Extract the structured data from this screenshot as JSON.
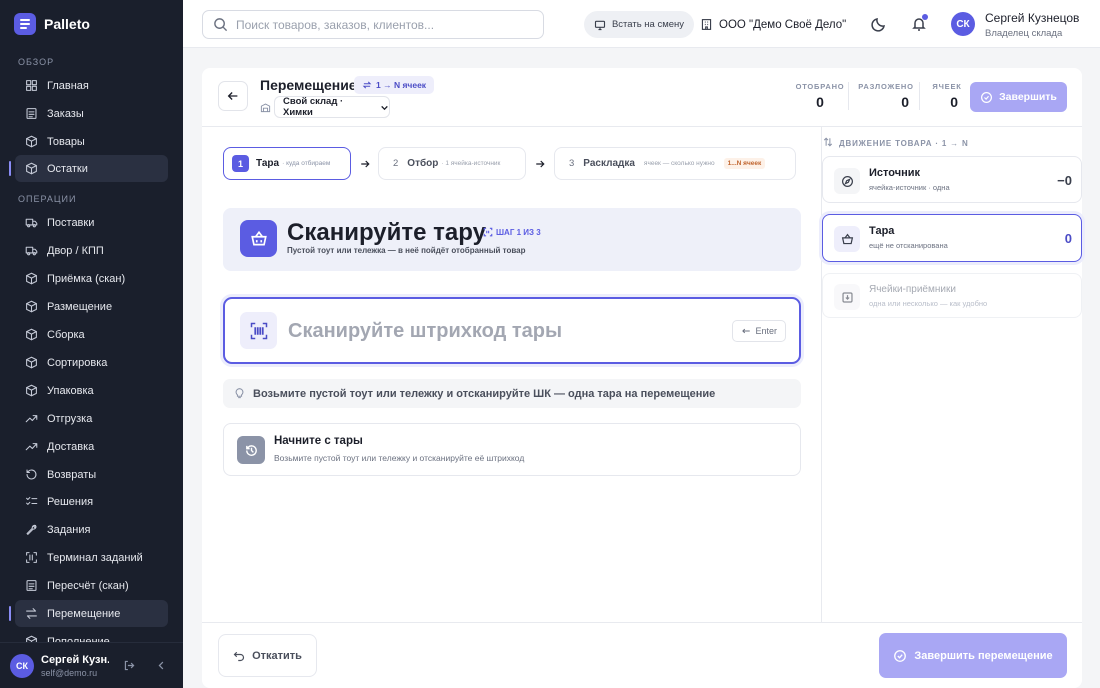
{
  "brand": {
    "name": "Palleto"
  },
  "sidebar": {
    "section_overview": "ОБЗОР",
    "section_operations": "ОПЕРАЦИИ",
    "items": [
      {
        "label": "Главная",
        "icon": "grid-icon"
      },
      {
        "label": "Заказы",
        "icon": "list-icon"
      },
      {
        "label": "Товары",
        "icon": "box-icon"
      },
      {
        "label": "Остатки",
        "icon": "box-icon"
      },
      {
        "label": "Поставки",
        "icon": "truck-icon"
      },
      {
        "label": "Двор / КПП",
        "icon": "truck-icon"
      },
      {
        "label": "Приёмка (скан)",
        "icon": "box-icon"
      },
      {
        "label": "Размещение",
        "icon": "box-icon"
      },
      {
        "label": "Сборка",
        "icon": "box-icon"
      },
      {
        "label": "Сортировка",
        "icon": "box-icon"
      },
      {
        "label": "Упаковка",
        "icon": "box-icon"
      },
      {
        "label": "Отгрузка",
        "icon": "trend-up-icon"
      },
      {
        "label": "Доставка",
        "icon": "trend-up-icon"
      },
      {
        "label": "Возвраты",
        "icon": "rotate-ccw-icon"
      },
      {
        "label": "Решения",
        "icon": "list-checks-icon"
      },
      {
        "label": "Задания",
        "icon": "wrench-icon"
      },
      {
        "label": "Терминал заданий",
        "icon": "scan-icon"
      },
      {
        "label": "Пересчёт (скан)",
        "icon": "list-icon"
      },
      {
        "label": "Перемещение",
        "icon": "arrows-swap-icon"
      },
      {
        "label": "Пополнение",
        "icon": "box-icon"
      }
    ],
    "user": {
      "initials": "СК",
      "name": "Сергей Кузнецов",
      "name_short": "Сергей Кузн...",
      "email": "self@demo.ru"
    }
  },
  "topbar": {
    "search_placeholder": "Поиск товаров, заказов, клиентов...",
    "shift_button": "Встать на смену",
    "org": "ООО \"Демо Своё Дело\"",
    "user_name": "Сергей Кузнецов",
    "user_role": "Владелец склада",
    "user_initials": "СК"
  },
  "header": {
    "title": "Перемещение",
    "mode_badge": "1 → N ячеек",
    "warehouse": "Свой склад · Химки",
    "stats": [
      {
        "label": "ОТОБРАНО",
        "value": "0"
      },
      {
        "label": "РАЗЛОЖЕНО",
        "value": "0"
      },
      {
        "label": "ЯЧЕЕК",
        "value": "0"
      }
    ],
    "finish_button": "Завершить"
  },
  "steps": [
    {
      "num": "1",
      "title": "Тара",
      "hint": "· куда отбираем"
    },
    {
      "num": "2",
      "title": "Отбор",
      "hint": "· 1 ячейка-источник"
    },
    {
      "num": "3",
      "title": "Раскладка",
      "hint": "ячеек — сколько нужно",
      "badge": "1...N ячеек"
    }
  ],
  "scan": {
    "title": "Сканируйте тару",
    "step_badge": "ШАГ 1 ИЗ 3",
    "subtitle": "Пустой тоут или тележка — в неё пойдёт отобранный товар",
    "input_placeholder": "Сканируйте штрихкод тары",
    "enter_button": "Enter",
    "tip": "Возьмите пустой тоут или тележку и отсканируйте ШК — одна тара на перемещение"
  },
  "start_card": {
    "title": "Начните с тары",
    "text": "Возьмите пустой тоут или тележку и отсканируйте её штрихкод"
  },
  "movement": {
    "heading": "ДВИЖЕНИЕ ТОВАРА · 1 → N",
    "cards": [
      {
        "title": "Источник",
        "sub": "ячейка-источник · одна",
        "value": "−0"
      },
      {
        "title": "Тара",
        "sub": "ещё не отсканирована",
        "value": "0"
      },
      {
        "title": "Ячейки-приёмники",
        "sub": "одна или несколько — как удобно",
        "value": ""
      }
    ]
  },
  "footer": {
    "rollback": "Откатить",
    "finish_move": "Завершить перемещение"
  },
  "colors": {
    "accent": "#5b5ce2",
    "accent_light": "#a9a7f4",
    "sidebar_bg": "#1a1f2c"
  }
}
